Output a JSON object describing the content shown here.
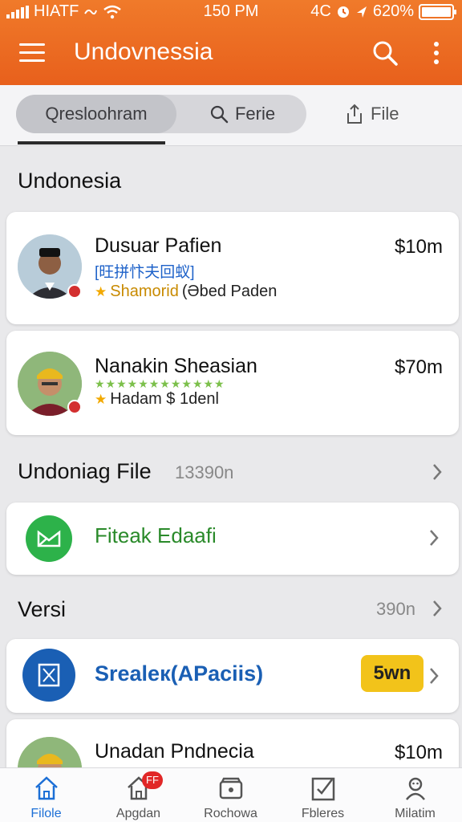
{
  "status_bar": {
    "carrier": "HIATF",
    "time": "150 PM",
    "right_text": "4C",
    "battery": "620%"
  },
  "app_bar": {
    "title": "Undovnessia"
  },
  "tabs": {
    "active": "Qresloohram",
    "second": "Ferie",
    "file": "File"
  },
  "section1": {
    "title": "Undonesia",
    "items": [
      {
        "name": "Dusuar Pafien",
        "price": "$10m",
        "subline": "[旺拼忭夫回蚁]",
        "meta_highlight": "Shamorid",
        "meta_rest": "(Əbed Paden"
      },
      {
        "name": "Nanakin Sheasian",
        "price": "$70m",
        "stars": "★★★★★★★★★★★★",
        "meta_rest": "Hadam $ 1denl"
      }
    ]
  },
  "section2": {
    "title": "Undoniag File",
    "count": "13390n"
  },
  "file_row": {
    "label": "Fiteak Edaafi"
  },
  "section3": {
    "title": "Versi",
    "count": "390n"
  },
  "versi_row": {
    "label": "Srealeк(APaciis)",
    "badge": "5wn"
  },
  "partial_item": {
    "name": "Unadan Pndnecia",
    "price": "$10m"
  },
  "bottom_nav": [
    {
      "label": "Filole",
      "icon": "home-icon"
    },
    {
      "label": "Apgdan",
      "icon": "home-icon",
      "badge": "FF"
    },
    {
      "label": "Rochowa",
      "icon": "wallet-icon"
    },
    {
      "label": "Fbleres",
      "icon": "checkbox-icon"
    },
    {
      "label": "Milatim",
      "icon": "profile-icon"
    }
  ],
  "colors": {
    "accent": "#e8601c",
    "nav_active": "#1c6fd6",
    "badge_yellow": "#f2c31a",
    "green": "#2db24a",
    "blue": "#1a5fb4"
  }
}
